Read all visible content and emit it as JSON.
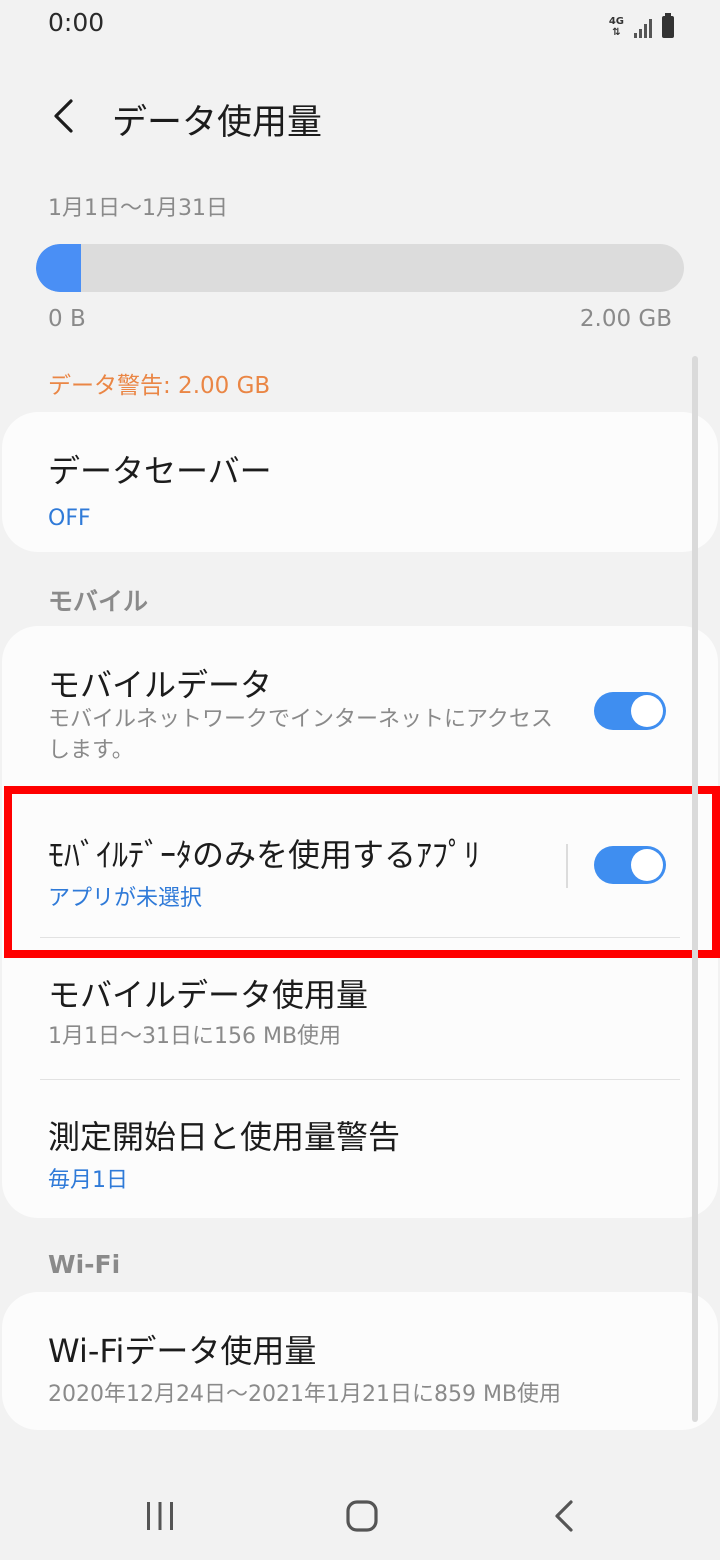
{
  "status_bar": {
    "time": "0:00",
    "network": "4G"
  },
  "header": {
    "title": "データ使用量"
  },
  "usage": {
    "period": "1月1日〜1月31日",
    "min_label": "0 B",
    "max_label": "2.00 GB",
    "used_fraction": 0.07,
    "warning": "データ警告: 2.00 GB"
  },
  "data_saver": {
    "title": "データセーバー",
    "status": "OFF"
  },
  "mobile_section": {
    "label": "モバイル",
    "mobile_data": {
      "title": "モバイルデータ",
      "description": "モバイルネットワークでインターネットにアクセスします。",
      "enabled": true
    },
    "mobile_only_apps": {
      "title": "ﾓﾊﾞｲﾙﾃﾞｰﾀのみを使用するｱﾌﾟﾘ",
      "status": "アプリが未選択",
      "enabled": true
    },
    "mobile_usage": {
      "title": "モバイルデータ使用量",
      "summary": "1月1日〜31日に156 MB使用"
    },
    "billing_cycle": {
      "title": "測定開始日と使用量警告",
      "value": "毎月1日"
    }
  },
  "wifi_section": {
    "label": "Wi-Fi",
    "wifi_usage": {
      "title": "Wi-Fiデータ使用量",
      "summary": "2020年12月24日〜2021年1月21日に859 MB使用"
    }
  },
  "colors": {
    "accent": "#3f8ef0",
    "warning": "#ea8645",
    "highlight": "#ff0000",
    "link": "#2f7ad8"
  }
}
